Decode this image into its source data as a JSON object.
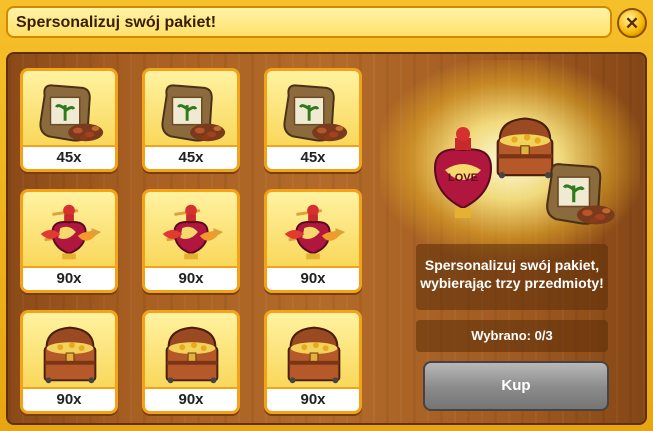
{
  "dialog": {
    "title": "Spersonalizuj swój pakiet!",
    "close_icon": "close-icon"
  },
  "items": [
    {
      "label": "45x",
      "icon": "seed-bag-icon"
    },
    {
      "label": "45x",
      "icon": "seed-bag-icon"
    },
    {
      "label": "45x",
      "icon": "seed-bag-icon"
    },
    {
      "label": "90x",
      "icon": "love-potion-icon"
    },
    {
      "label": "90x",
      "icon": "love-potion-icon"
    },
    {
      "label": "90x",
      "icon": "love-potion-icon"
    },
    {
      "label": "90x",
      "icon": "treasure-chest-icon"
    },
    {
      "label": "90x",
      "icon": "treasure-chest-icon"
    },
    {
      "label": "90x",
      "icon": "treasure-chest-icon"
    }
  ],
  "sidebar": {
    "instruction": "Spersonalizuj swój pakiet, wybierając trzy przedmioty!",
    "selected": "Wybrano: 0/3",
    "buy_label": "Kup",
    "promo_love_text": "LOVE"
  },
  "colors": {
    "frame": "#f2b418",
    "wood": "#a85f22",
    "buy_button": "#8a8a8a"
  }
}
